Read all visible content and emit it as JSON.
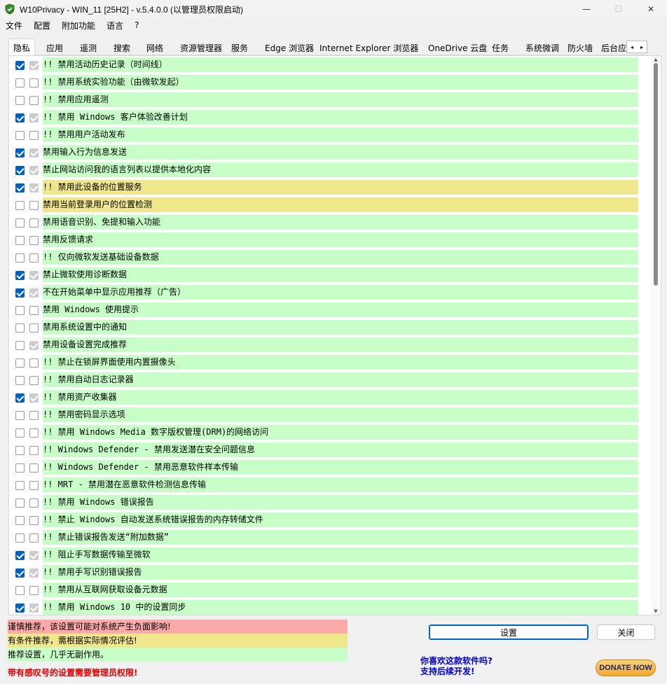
{
  "window": {
    "title": "W10Privacy - WIN_11 [25H2]  - v.5.4.0.0 (以管理员权限启动)",
    "minimize": "—",
    "maximize": "☐",
    "close": "✕"
  },
  "menu": [
    "文件",
    "配置",
    "附加功能",
    "语言",
    "?"
  ],
  "tabs": [
    "隐私",
    "应用",
    "遥测",
    "搜索",
    "网络",
    "资源管理器",
    "服务",
    "Edge 浏览器",
    "Internet Explorer 浏览器",
    "OneDrive 云盘",
    "任务",
    "系统微调",
    "防火墙",
    "后台应"
  ],
  "tab_scroll": {
    "left": "◂",
    "right": "▸"
  },
  "settings": [
    {
      "label": "!! 禁用活动历史记录（时间线）",
      "checked": true,
      "default": true,
      "color": "green"
    },
    {
      "label": "!! 禁用系统实验功能（由微软发起）",
      "checked": false,
      "default": false,
      "color": "green"
    },
    {
      "label": "!! 禁用应用遥测",
      "checked": false,
      "default": false,
      "color": "green"
    },
    {
      "label": "!! 禁用 Windows 客户体验改善计划",
      "checked": true,
      "default": true,
      "color": "green"
    },
    {
      "label": "!! 禁用用户活动发布",
      "checked": false,
      "default": false,
      "color": "green"
    },
    {
      "label": "禁用输入行为信息发送",
      "checked": true,
      "default": true,
      "color": "green"
    },
    {
      "label": "禁止网站访问我的语言列表以提供本地化内容",
      "checked": true,
      "default": true,
      "color": "green"
    },
    {
      "label": "!! 禁用此设备的位置服务",
      "checked": true,
      "default": true,
      "color": "yellow"
    },
    {
      "label": "禁用当前登录用户的位置检测",
      "checked": false,
      "default": false,
      "color": "yellow"
    },
    {
      "label": "禁用语音识别、免提和输入功能",
      "checked": false,
      "default": false,
      "color": "green"
    },
    {
      "label": "禁用反馈请求",
      "checked": false,
      "default": false,
      "color": "green"
    },
    {
      "label": "!! 仅向微软发送基础设备数据",
      "checked": false,
      "default": false,
      "color": "green"
    },
    {
      "label": "禁止微软使用诊断数据",
      "checked": true,
      "default": true,
      "color": "green"
    },
    {
      "label": "不在开始菜单中显示应用推荐（广告）",
      "checked": true,
      "default": true,
      "color": "green"
    },
    {
      "label": "禁用 Windows 使用提示",
      "checked": false,
      "default": false,
      "color": "green"
    },
    {
      "label": "禁用系统设置中的通知",
      "checked": false,
      "default": false,
      "color": "green"
    },
    {
      "label": "禁用设备设置完成推荐",
      "checked": false,
      "default": true,
      "color": "green"
    },
    {
      "label": "!! 禁止在锁屏界面使用内置摄像头",
      "checked": false,
      "default": false,
      "color": "green"
    },
    {
      "label": "!! 禁用自动日志记录器",
      "checked": false,
      "default": false,
      "color": "green"
    },
    {
      "label": "!! 禁用资产收集器",
      "checked": true,
      "default": true,
      "color": "green"
    },
    {
      "label": "!! 禁用密码显示选项",
      "checked": false,
      "default": false,
      "color": "green"
    },
    {
      "label": "!! 禁用 Windows Media 数字版权管理(DRM)的网络访问",
      "checked": false,
      "default": false,
      "color": "green"
    },
    {
      "label": "!! Windows Defender - 禁用发送潜在安全问题信息",
      "checked": false,
      "default": false,
      "color": "green"
    },
    {
      "label": "!! Windows Defender - 禁用恶意软件样本传输",
      "checked": false,
      "default": false,
      "color": "green"
    },
    {
      "label": "!! MRT - 禁用潜在恶意软件检测信息传输",
      "checked": false,
      "default": false,
      "color": "green"
    },
    {
      "label": "!! 禁用 Windows 错误报告",
      "checked": false,
      "default": false,
      "color": "green"
    },
    {
      "label": "!! 禁止 Windows 自动发送系统错误报告的内存转储文件",
      "checked": false,
      "default": false,
      "color": "green"
    },
    {
      "label": "!! 禁止错误报告发送“附加数据”",
      "checked": false,
      "default": false,
      "color": "green"
    },
    {
      "label": "!! 阻止手写数据传输至微软",
      "checked": true,
      "default": true,
      "color": "green"
    },
    {
      "label": "!! 禁用手写识别错误报告",
      "checked": true,
      "default": true,
      "color": "green"
    },
    {
      "label": "!! 禁用从互联网获取设备元数据",
      "checked": false,
      "default": false,
      "color": "green"
    },
    {
      "label": "!! 禁用 Windows 10 中的设置同步",
      "checked": true,
      "default": true,
      "color": "green"
    }
  ],
  "legend": {
    "red": "谨慎推荐，该设置可能对系统产生负面影响!",
    "yellow": "有条件推荐，需根据实际情况评估!",
    "green": "推荐设置，几乎无副作用。"
  },
  "admin_warning": "带有感叹号的设置需要管理员权限!",
  "buttons": {
    "apply": "设置",
    "close": "关闭"
  },
  "ask": {
    "line1": "你喜欢这款软件吗?",
    "line2": "支持后续开发!"
  },
  "donate": "DONATE NOW",
  "colors": {
    "green": "#c8ffc8",
    "yellow": "#f0e68c",
    "red": "#ffaaaa",
    "accent": "#0060c0"
  }
}
